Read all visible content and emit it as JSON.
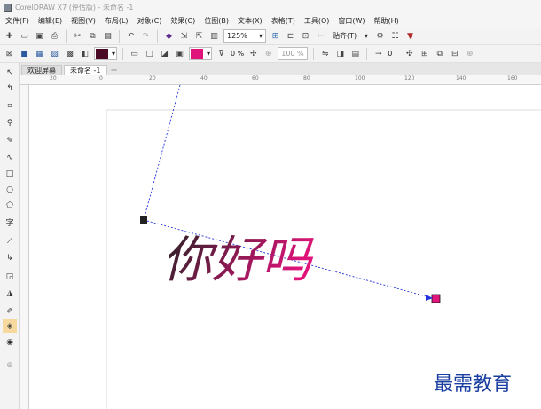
{
  "window": {
    "title": "CorelDRAW X7 (评估版) - 未命名 -1"
  },
  "menu": [
    "文件(F)",
    "编辑(E)",
    "视图(V)",
    "布局(L)",
    "对象(C)",
    "效果(C)",
    "位图(B)",
    "文本(X)",
    "表格(T)",
    "工具(O)",
    "窗口(W)",
    "帮助(H)"
  ],
  "toolbar": {
    "zoom": "125%",
    "snap_label": "贴齐(T)"
  },
  "propbar": {
    "fill_color": "#e0147a",
    "dark_color": "#4a0a25",
    "transparency": "0 %",
    "mid": "100 %",
    "angle": "0"
  },
  "tabs": {
    "welcome": "欢迎屏幕",
    "doc": "未命名 -1"
  },
  "ruler": [
    "20",
    "0",
    "20",
    "40",
    "60",
    "80",
    "100",
    "120",
    "140",
    "160"
  ],
  "canvas": {
    "text": "你好吗",
    "watermark": "最需教育",
    "start_color": "#222222",
    "end_color": "#e0147a"
  }
}
